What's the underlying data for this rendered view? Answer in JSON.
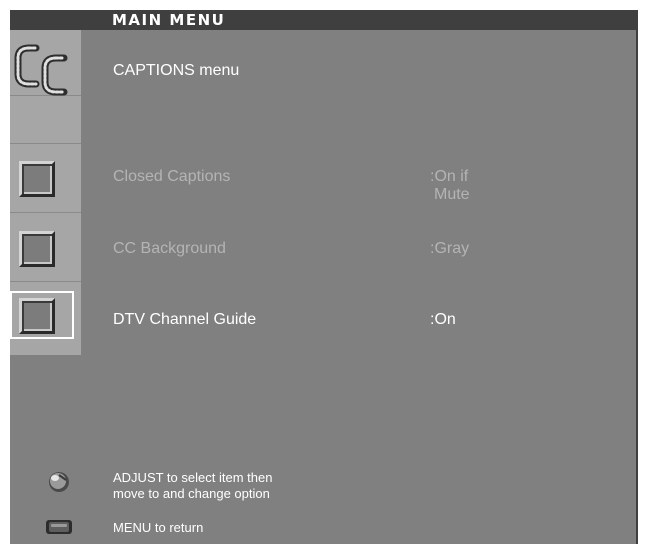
{
  "header": {
    "title": "MAIN MENU"
  },
  "submenu": {
    "title": "CAPTIONS menu",
    "icon": "cc-icon"
  },
  "items": [
    {
      "label": "Closed Captions",
      "value": ":On if",
      "value_line2": "Mute",
      "selected": false
    },
    {
      "label": "CC Background",
      "value": ":Gray",
      "selected": false
    },
    {
      "label": "DTV Channel Guide",
      "value": ":On",
      "selected": true
    }
  ],
  "footer": {
    "adjust_line1": "ADJUST to select item then",
    "adjust_line2": "move to and change option",
    "menu_hint": "MENU to return"
  },
  "colors": {
    "panel": "#808080",
    "frame": "#3f3f3f",
    "icon_column": "#a6a6a6",
    "disabled_text": "#b4b4b4",
    "active_text": "#ffffff"
  }
}
